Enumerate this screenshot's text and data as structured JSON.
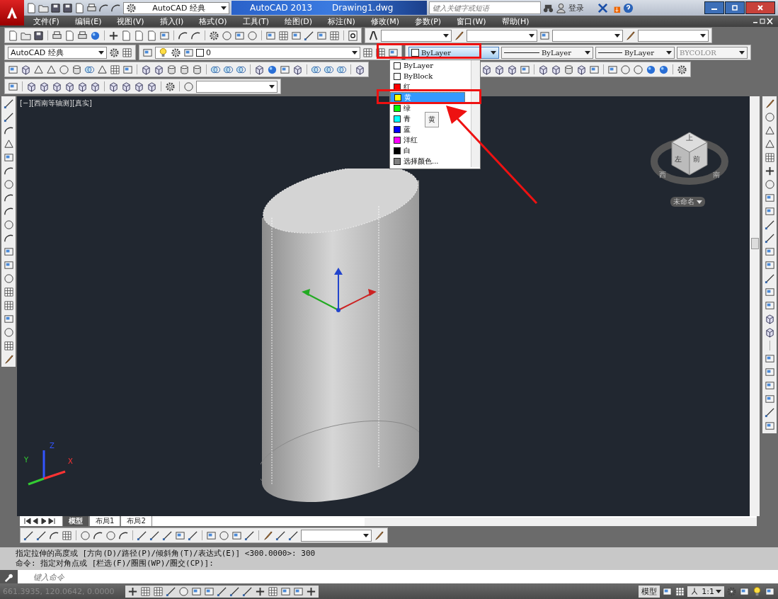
{
  "title_bar": {
    "workspace": "AutoCAD 经典",
    "app_title": "AutoCAD 2013",
    "document": "Drawing1.dwg",
    "search_placeholder": "键入关键字或短语",
    "sign_in": "登录"
  },
  "menu": [
    "文件(F)",
    "编辑(E)",
    "视图(V)",
    "插入(I)",
    "格式(O)",
    "工具(T)",
    "绘图(D)",
    "标注(N)",
    "修改(M)",
    "参数(P)",
    "窗口(W)",
    "帮助(H)"
  ],
  "workspace_toolbar": {
    "workspace": "AutoCAD 经典"
  },
  "layer_combo": {
    "value": "0"
  },
  "properties": {
    "color_setting": "ByLayer",
    "linetype": "ByLayer",
    "lineweight": "ByLayer",
    "plot_style": "BYCOLOR"
  },
  "color_dropdown": {
    "tooltip": "黄",
    "items": [
      {
        "label": "ByLayer",
        "color": "#ffffff",
        "selected": false
      },
      {
        "label": "ByBlock",
        "color": "#ffffff",
        "selected": false
      },
      {
        "label": "红",
        "color": "#ff0000",
        "selected": false
      },
      {
        "label": "黄",
        "color": "#ffff00",
        "selected": true
      },
      {
        "label": "绿",
        "color": "#00ff00",
        "selected": false
      },
      {
        "label": "青",
        "color": "#00ffff",
        "selected": false
      },
      {
        "label": "蓝",
        "color": "#0000ff",
        "selected": false
      },
      {
        "label": "洋红",
        "color": "#ff00ff",
        "selected": false
      },
      {
        "label": "白",
        "color": "#000000",
        "selected": false
      },
      {
        "label": "选择颜色...",
        "color": "#808080",
        "selected": false
      }
    ]
  },
  "viewport": {
    "label": "[−][西南等轴测][真实]",
    "viewcube": {
      "top": "上",
      "left": "左",
      "front": "前",
      "west": "西",
      "south": "南",
      "view_name": "未命名"
    },
    "ucs": {
      "x": "X",
      "y": "Y",
      "z": "Z"
    }
  },
  "layout_tabs": [
    {
      "label": "模型",
      "selected": true
    },
    {
      "label": "布局1",
      "selected": false
    },
    {
      "label": "布局2",
      "selected": false
    }
  ],
  "command_history": [
    "指定拉伸的高度或 [方向(D)/路径(P)/倾斜角(T)/表达式(E)] <300.0000>: 300",
    "命令: 指定对角点或 [栏选(F)/圈围(WP)/圈交(CP)]:"
  ],
  "command_input": {
    "placeholder": "键入命令"
  },
  "status_bar": {
    "coordinates": "661.3935, 120.0642, 0.0000",
    "model": "模型",
    "annotation_scale": "1:1"
  }
}
